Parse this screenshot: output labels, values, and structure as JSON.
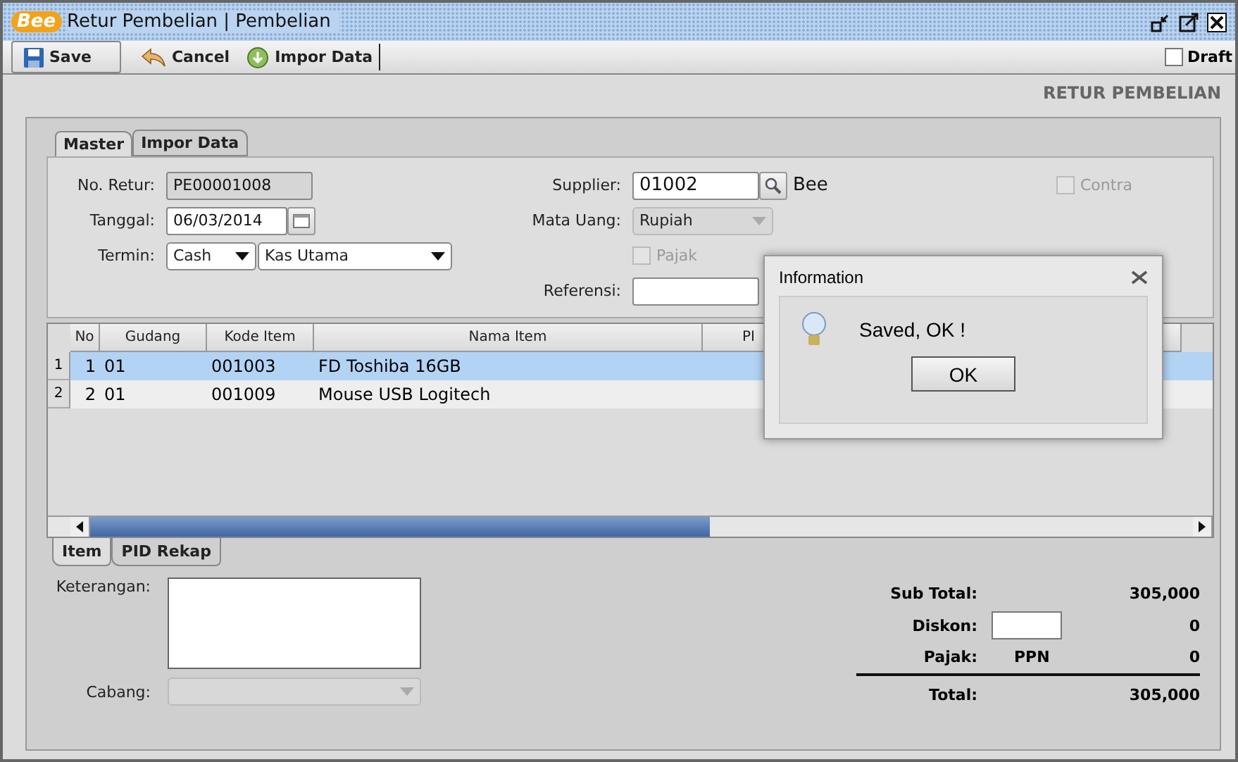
{
  "window": {
    "logo": "Bee",
    "title": "Retur Pembelian | Pembelian"
  },
  "toolbar": {
    "buttons": [
      {
        "label": "Save",
        "kind": "save"
      },
      {
        "label": "Cancel",
        "kind": "cancel"
      },
      {
        "label": "Impor Data",
        "kind": "import"
      }
    ],
    "draft": {
      "label": "Draft",
      "checked": false
    }
  },
  "heading": "RETUR PEMBELIAN",
  "tabs": [
    {
      "label": "Master",
      "selected": true
    },
    {
      "label": "Impor Data",
      "selected": false
    }
  ],
  "form": {
    "no_retur": {
      "label": "No. Retur:",
      "value": "PE00001008"
    },
    "tanggal": {
      "label": "Tanggal:",
      "value": "06/03/2014"
    },
    "termin": {
      "label": "Termin:",
      "value": "Cash",
      "account": "Kas Utama"
    },
    "supplier": {
      "label": "Supplier:",
      "value": "01002",
      "name": "Bee"
    },
    "mata_uang": {
      "label": "Mata Uang:",
      "value": "Rupiah",
      "disabled": true
    },
    "pajak": {
      "label": "Pajak",
      "checked": false,
      "disabled": true
    },
    "referensi": {
      "label": "Referensi:"
    },
    "contra": {
      "label": "Contra",
      "checked": false,
      "disabled": true
    }
  },
  "table": {
    "columns": [
      "No",
      "Gudang",
      "Kode Item",
      "Nama Item",
      "PI"
    ],
    "rows": [
      {
        "row_header": "1",
        "cells": [
          "1",
          "01",
          "001003",
          "FD Toshiba 16GB"
        ],
        "selected": true
      },
      {
        "row_header": "2",
        "cells": [
          "2",
          "01",
          "001009",
          "Mouse USB Logitech"
        ],
        "selected": false
      }
    ]
  },
  "bottom_tabs": [
    {
      "label": "Item",
      "selected": true
    },
    {
      "label": "PID Rekap",
      "selected": false
    }
  ],
  "notes": {
    "keterangan_label": "Keterangan:",
    "cabang_label": "Cabang:"
  },
  "totals": {
    "sub_total": {
      "label": "Sub Total:",
      "value": "305,000"
    },
    "diskon": {
      "label": "Diskon:",
      "value": "0"
    },
    "pajak": {
      "label": "Pajak:",
      "type": "PPN",
      "value": "0"
    },
    "total": {
      "label": "Total:",
      "value": "305,000"
    }
  },
  "dialog": {
    "title": "Information",
    "message": "Saved, OK !",
    "button": "OK"
  }
}
